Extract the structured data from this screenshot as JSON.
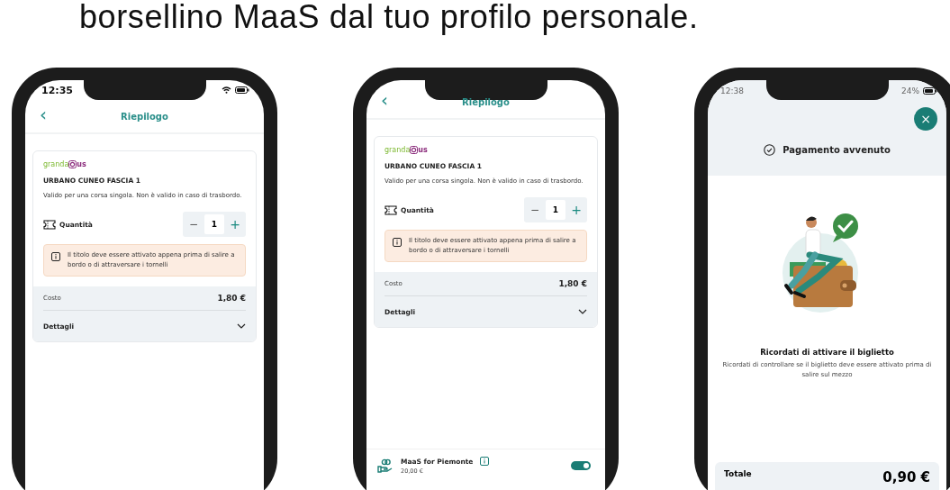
{
  "heading": "borsellino MaaS dal tuo profilo personale.",
  "phones": [
    {
      "kind": "summary",
      "status": {
        "time": "12:35"
      },
      "header": {
        "back": "‹",
        "title": "Riepilogo"
      },
      "ticket": {
        "logo_part_1": "granda",
        "logo_part_2": "us",
        "title": "URBANO CUNEO FASCIA 1",
        "description": "Valido per una corsa singola. Non è valido in caso di trasbordo.",
        "quantity_label": "Quantità",
        "stepper": {
          "minus": "−",
          "value": "1",
          "plus": "+"
        },
        "notice": "Il titolo deve essere attivato appena prima di salire a bordo o di attraversare i tornelli",
        "cost_label": "Costo",
        "cost_value": "1,80 €",
        "details_label": "Dettagli"
      }
    },
    {
      "kind": "summary",
      "header": {
        "back": "‹",
        "title": "Riepilogo"
      },
      "ticket": {
        "logo_part_1": "granda",
        "logo_part_2": "us",
        "title": "URBANO CUNEO FASCIA 1",
        "description": "Valido per una corsa singola. Non è valido in caso di trasbordo.",
        "quantity_label": "Quantità",
        "stepper": {
          "minus": "−",
          "value": "1",
          "plus": "+"
        },
        "notice": "Il titolo deve essere attivato appena prima di salire a bordo o di attraversare i tornelli",
        "cost_label": "Costo",
        "cost_value": "1,80 €",
        "details_label": "Dettagli"
      },
      "wallet": {
        "name": "MaaS for Piemonte",
        "balance": "20,00 €",
        "on": true
      }
    },
    {
      "kind": "payment",
      "status": {
        "time": "12:38",
        "battery": "24%"
      },
      "close": "×",
      "title": "Pagamento avvenuto",
      "message_title": "Ricordati di attivare il biglietto",
      "message": "Ricordati di controllare se il biglietto deve essere attivato prima di salire sul mezzo",
      "total_label": "Totale",
      "total_value": "0,90 €"
    }
  ]
}
